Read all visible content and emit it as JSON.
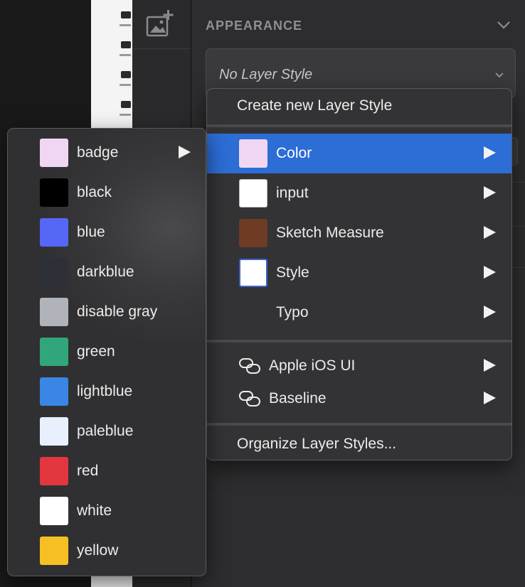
{
  "inspector": {
    "section_title": "APPEARANCE",
    "layer_style_value": "No Layer Style"
  },
  "main_menu": {
    "create_label": "Create new Layer Style",
    "items": [
      {
        "label": "Color",
        "swatch": "#f0d6f3",
        "highlighted": true
      },
      {
        "label": "input",
        "swatch": "#ffffff"
      },
      {
        "label": "Sketch Measure",
        "swatch": "#6e3b24"
      },
      {
        "label": "Style",
        "swatch": "#ffffff",
        "swatch_border": "#3d62c9"
      },
      {
        "label": "Typo"
      }
    ],
    "libraries": [
      {
        "label": "Apple iOS UI",
        "icon": "link-icon"
      },
      {
        "label": "Baseline",
        "icon": "link-icon"
      }
    ],
    "organize_label": "Organize Layer Styles..."
  },
  "color_submenu": {
    "items": [
      {
        "label": "badge",
        "swatch": "#f0d6f3",
        "has_submenu": true
      },
      {
        "label": "black",
        "swatch": "#000000"
      },
      {
        "label": "blue",
        "swatch": "#5667f5"
      },
      {
        "label": "darkblue",
        "swatch": "#2e3038"
      },
      {
        "label": "disable gray",
        "swatch": "#b0b3ba"
      },
      {
        "label": "green",
        "swatch": "#30a67a"
      },
      {
        "label": "lightblue",
        "swatch": "#3a86e4"
      },
      {
        "label": "paleblue",
        "swatch": "#e9f0fd"
      },
      {
        "label": "red",
        "swatch": "#e3363f"
      },
      {
        "label": "white",
        "swatch": "#ffffff"
      },
      {
        "label": "yellow",
        "swatch": "#f6c024"
      }
    ]
  },
  "colors": {
    "accent": "#2c6dd6",
    "menu_bg": "#333335",
    "text": "#ececec"
  }
}
